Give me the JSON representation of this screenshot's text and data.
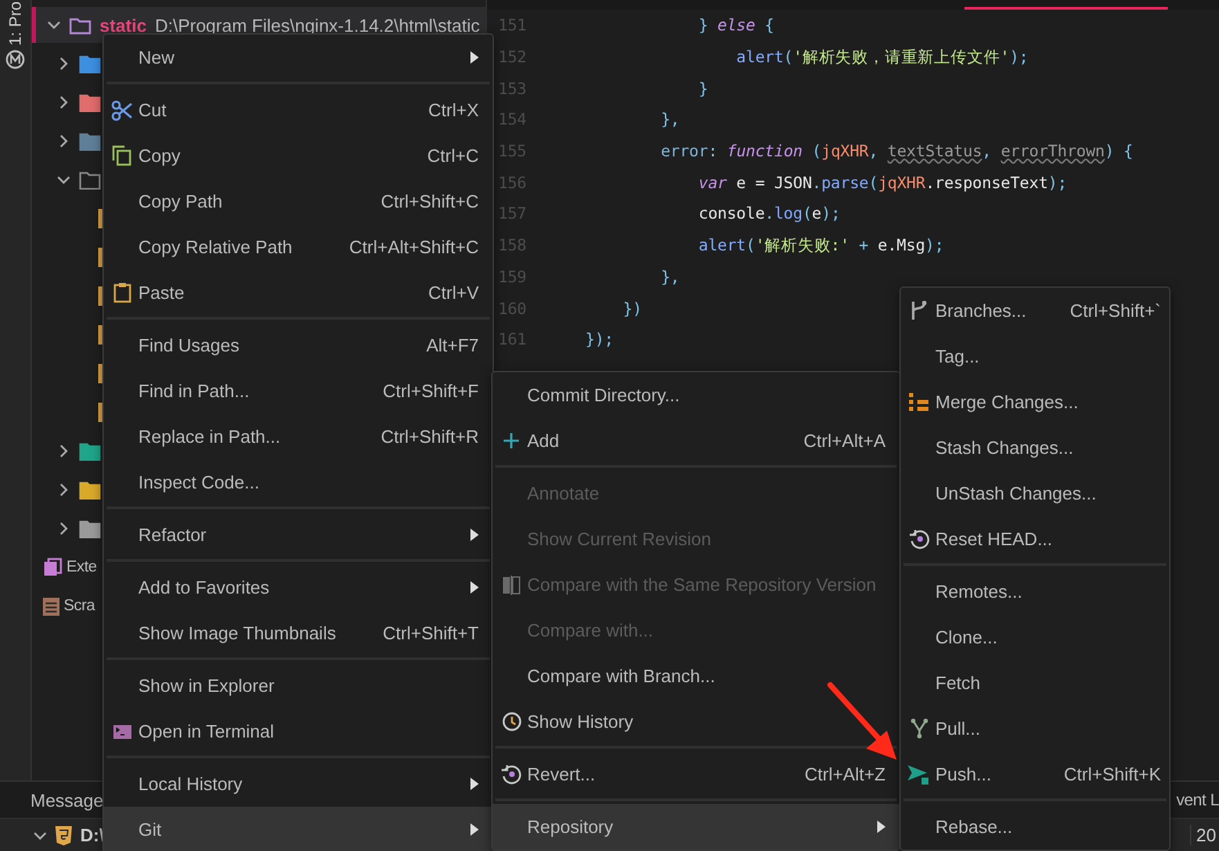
{
  "tool_strip": {
    "project_tab": "1: Pro"
  },
  "project": {
    "root": {
      "name": "static",
      "path": "D:\\Program Files\\nginx-1.14.2\\html\\static",
      "expanded": true
    },
    "items": [
      {
        "kind": "folder",
        "expanded": false
      },
      {
        "kind": "folder",
        "expanded": false
      },
      {
        "kind": "folder",
        "expanded": false
      },
      {
        "kind": "folder",
        "expanded": true,
        "children": [
          {
            "kind": "file"
          },
          {
            "kind": "file"
          },
          {
            "kind": "file"
          },
          {
            "kind": "file"
          },
          {
            "kind": "file"
          },
          {
            "kind": "file"
          }
        ]
      },
      {
        "kind": "folder",
        "expanded": false
      },
      {
        "kind": "folder",
        "expanded": false
      },
      {
        "kind": "folder",
        "expanded": false
      },
      {
        "kind": "library",
        "label": "Exte"
      },
      {
        "kind": "scratch",
        "label": "Scra"
      }
    ]
  },
  "editor": {
    "lines": [
      {
        "number": "151",
        "tokens": [
          {
            "kind": "punct",
            "text": "            } "
          },
          {
            "kind": "keyword",
            "text": "else"
          },
          {
            "kind": "punct",
            "text": " {"
          }
        ]
      },
      {
        "number": "152",
        "tokens": [
          {
            "kind": "call",
            "text": "                alert"
          },
          {
            "kind": "punct",
            "text": "("
          },
          {
            "kind": "string",
            "text": "'解析失败，请重新上传文件'"
          },
          {
            "kind": "punct",
            "text": ");"
          }
        ]
      },
      {
        "number": "153",
        "tokens": [
          {
            "kind": "punct",
            "text": "            }"
          }
        ]
      },
      {
        "number": "154",
        "tokens": [
          {
            "kind": "punct",
            "text": "        },"
          }
        ]
      },
      {
        "number": "155",
        "tokens": [
          {
            "kind": "property",
            "text": "        error"
          },
          {
            "kind": "punct",
            "text": ": "
          },
          {
            "kind": "keyword",
            "text": "function"
          },
          {
            "kind": "punct",
            "text": " ("
          },
          {
            "kind": "param",
            "text": "jqXHR"
          },
          {
            "kind": "punct",
            "text": ", "
          },
          {
            "kind": "unused",
            "text": "textStatus"
          },
          {
            "kind": "punct",
            "text": ", "
          },
          {
            "kind": "unused",
            "text": "errorThrown"
          },
          {
            "kind": "punct",
            "text": ") {"
          }
        ]
      },
      {
        "number": "156",
        "tokens": [
          {
            "kind": "keyword",
            "text": "            var"
          },
          {
            "kind": "plain",
            "text": " e = JSON"
          },
          {
            "kind": "punct",
            "text": "."
          },
          {
            "kind": "call",
            "text": "parse"
          },
          {
            "kind": "punct",
            "text": "("
          },
          {
            "kind": "param",
            "text": "jqXHR"
          },
          {
            "kind": "plain",
            "text": ".responseText"
          },
          {
            "kind": "punct",
            "text": ");"
          }
        ]
      },
      {
        "number": "157",
        "tokens": [
          {
            "kind": "plain",
            "text": "            console"
          },
          {
            "kind": "punct",
            "text": "."
          },
          {
            "kind": "call",
            "text": "log"
          },
          {
            "kind": "punct",
            "text": "("
          },
          {
            "kind": "plain",
            "text": "e"
          },
          {
            "kind": "punct",
            "text": ");"
          }
        ]
      },
      {
        "number": "158",
        "tokens": [
          {
            "kind": "call",
            "text": "            alert"
          },
          {
            "kind": "punct",
            "text": "("
          },
          {
            "kind": "string",
            "text": "'解析失败:'"
          },
          {
            "kind": "punct",
            "text": " + "
          },
          {
            "kind": "plain",
            "text": "e.Msg"
          },
          {
            "kind": "punct",
            "text": ");"
          }
        ]
      },
      {
        "number": "159",
        "tokens": [
          {
            "kind": "punct",
            "text": "        },"
          }
        ]
      },
      {
        "number": "160",
        "tokens": [
          {
            "kind": "punct",
            "text": "    })"
          }
        ]
      },
      {
        "number": "161",
        "tokens": [
          {
            "kind": "punct",
            "text": "});"
          }
        ]
      }
    ]
  },
  "context_menu": {
    "items": [
      {
        "kind": "item",
        "label": "New",
        "submenu": true,
        "selected": false
      },
      {
        "kind": "separator"
      },
      {
        "kind": "item",
        "label": "Cut",
        "shortcut": "Ctrl+X",
        "selected": false
      },
      {
        "kind": "item",
        "label": "Copy",
        "shortcut": "Ctrl+C",
        "selected": false
      },
      {
        "kind": "item",
        "label": "Copy Path",
        "shortcut": "Ctrl+Shift+C",
        "selected": false
      },
      {
        "kind": "item",
        "label": "Copy Relative Path",
        "shortcut": "Ctrl+Alt+Shift+C",
        "selected": false
      },
      {
        "kind": "item",
        "label": "Paste",
        "shortcut": "Ctrl+V",
        "selected": false
      },
      {
        "kind": "separator"
      },
      {
        "kind": "item",
        "label": "Find Usages",
        "shortcut": "Alt+F7",
        "selected": false
      },
      {
        "kind": "item",
        "label": "Find in Path...",
        "shortcut": "Ctrl+Shift+F",
        "selected": false
      },
      {
        "kind": "item",
        "label": "Replace in Path...",
        "shortcut": "Ctrl+Shift+R",
        "selected": false
      },
      {
        "kind": "item",
        "label": "Inspect Code...",
        "selected": false
      },
      {
        "kind": "separator"
      },
      {
        "kind": "item",
        "label": "Refactor",
        "submenu": true,
        "selected": false
      },
      {
        "kind": "separator"
      },
      {
        "kind": "item",
        "label": "Add to Favorites",
        "submenu": true,
        "selected": false
      },
      {
        "kind": "item",
        "label": "Show Image Thumbnails",
        "shortcut": "Ctrl+Shift+T",
        "selected": false
      },
      {
        "kind": "separator"
      },
      {
        "kind": "item",
        "label": "Show in Explorer",
        "selected": false
      },
      {
        "kind": "item",
        "label": "Open in Terminal",
        "selected": false
      },
      {
        "kind": "separator"
      },
      {
        "kind": "item",
        "label": "Local History",
        "submenu": true,
        "selected": false
      },
      {
        "kind": "item",
        "label": "Git",
        "submenu": true,
        "selected": true
      }
    ]
  },
  "git_menu": {
    "items": [
      {
        "kind": "item",
        "label": "Commit Directory...",
        "selected": false
      },
      {
        "kind": "item",
        "label": "Add",
        "shortcut": "Ctrl+Alt+A",
        "selected": false
      },
      {
        "kind": "separator"
      },
      {
        "kind": "item",
        "label": "Annotate",
        "disabled": true,
        "selected": false
      },
      {
        "kind": "item",
        "label": "Show Current Revision",
        "disabled": true,
        "selected": false
      },
      {
        "kind": "item",
        "label": "Compare with the Same Repository Version",
        "disabled": true,
        "selected": false
      },
      {
        "kind": "item",
        "label": "Compare with...",
        "disabled": true,
        "selected": false
      },
      {
        "kind": "item",
        "label": "Compare with Branch...",
        "selected": false
      },
      {
        "kind": "item",
        "label": "Show History",
        "selected": false
      },
      {
        "kind": "separator"
      },
      {
        "kind": "item",
        "label": "Revert...",
        "shortcut": "Ctrl+Alt+Z",
        "selected": false
      },
      {
        "kind": "separator"
      },
      {
        "kind": "item",
        "label": "Repository",
        "submenu": true,
        "selected": true
      }
    ]
  },
  "repository_menu": {
    "items": [
      {
        "kind": "item",
        "label": "Branches...",
        "shortcut": "Ctrl+Shift+`",
        "selected": false
      },
      {
        "kind": "item",
        "label": "Tag...",
        "selected": false
      },
      {
        "kind": "item",
        "label": "Merge Changes...",
        "selected": false
      },
      {
        "kind": "item",
        "label": "Stash Changes...",
        "selected": false
      },
      {
        "kind": "item",
        "label": "UnStash Changes...",
        "selected": false
      },
      {
        "kind": "item",
        "label": "Reset HEAD...",
        "selected": false
      },
      {
        "kind": "separator"
      },
      {
        "kind": "item",
        "label": "Remotes...",
        "selected": false
      },
      {
        "kind": "item",
        "label": "Clone...",
        "selected": false
      },
      {
        "kind": "item",
        "label": "Fetch",
        "selected": false
      },
      {
        "kind": "item",
        "label": "Pull...",
        "selected": false
      },
      {
        "kind": "item",
        "label": "Push...",
        "shortcut": "Ctrl+Shift+K",
        "selected": false
      },
      {
        "kind": "separator"
      },
      {
        "kind": "item",
        "label": "Rebase...",
        "selected": false
      }
    ]
  },
  "bottom": {
    "messages_tab": "Message",
    "event_tab": "vent L",
    "row_path": "D:\\",
    "row_value": "20"
  }
}
